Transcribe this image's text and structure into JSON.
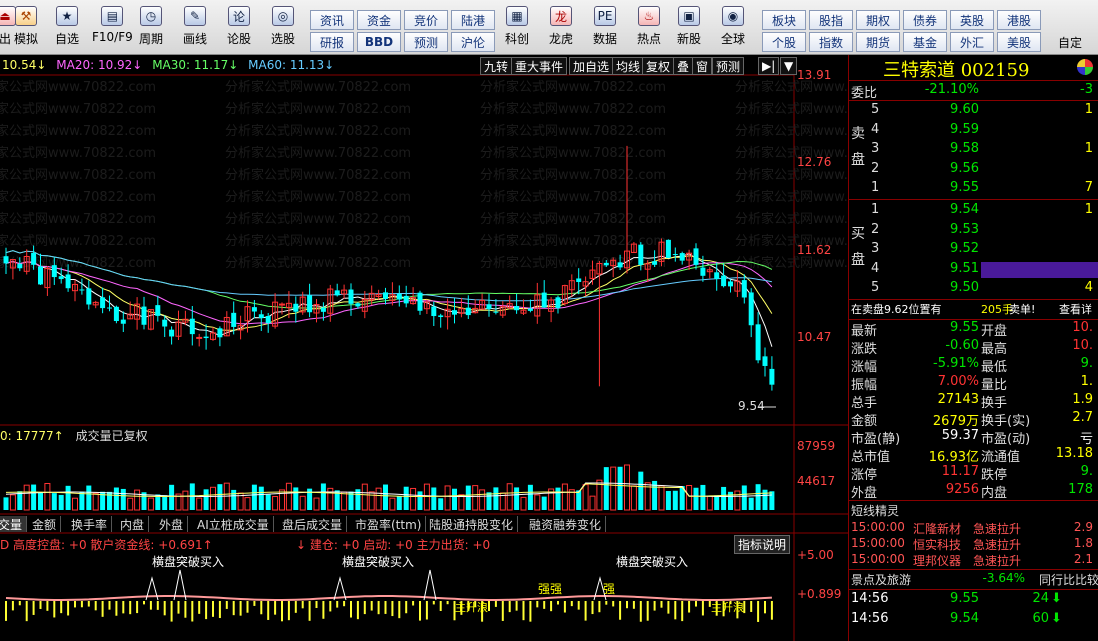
{
  "toolbar": {
    "items": [
      {
        "label": "出",
        "icon": "exit-icon"
      },
      {
        "label": "模拟",
        "icon": "hammer-icon"
      },
      {
        "label": "自选",
        "icon": "star-icon"
      },
      {
        "label": "F10/F9",
        "icon": "f10-icon"
      },
      {
        "label": "周期",
        "icon": "clock-icon"
      },
      {
        "label": "画线",
        "icon": "pen-icon"
      },
      {
        "label": "论股",
        "icon": "chat-icon"
      },
      {
        "label": "选股",
        "icon": "chart-search-icon"
      }
    ],
    "grid_top": [
      "资讯",
      "资金",
      "竞价",
      "陆港"
    ],
    "grid_bottom": [
      "研报",
      "BBD",
      "预测",
      "沪伦"
    ],
    "mid": [
      {
        "label": "科创",
        "icon": "kechuang-icon"
      },
      {
        "label": "龙虎",
        "icon": "dragon-icon"
      },
      {
        "label": "数据",
        "icon": "pe-icon"
      },
      {
        "label": "热点",
        "icon": "hot-icon"
      },
      {
        "label": "新股",
        "icon": "newstock-icon"
      },
      {
        "label": "全球",
        "icon": "globe-icon"
      }
    ],
    "grid2_top": [
      "板块",
      "股指",
      "期权",
      "债券",
      "英股",
      "港股"
    ],
    "grid2_bottom": [
      "个股",
      "指数",
      "期货",
      "基金",
      "外汇",
      "美股"
    ],
    "custom": "自定"
  },
  "ma_legend": {
    "ma10": "10.54↓",
    "ma20": "MA20: 10.92↓",
    "ma30": "MA30: 11.17↓",
    "ma60": "MA60: 11.13↓"
  },
  "chart_buttons": [
    "九转",
    "重大事件",
    "加自选",
    "均线",
    "复权",
    "叠",
    "窗",
    "预测",
    "▶|",
    "▼"
  ],
  "watermark": "分析家公式网www.70822.com",
  "price_axis": [
    "13.91",
    "12.76",
    "11.62",
    "10.47"
  ],
  "last_price_label": "9.54",
  "volume_header": {
    "vol": "0: 17777↑",
    "note": "成交量已复权"
  },
  "volume_axis": [
    "87959",
    "44617"
  ],
  "tabs": [
    "交量",
    "金额",
    "换手率",
    "内盘",
    "外盘",
    "AI立桩成交量",
    "盘后成交量",
    "市盈率(ttm)",
    "陆股通持股变化",
    "融资融券变化"
  ],
  "indicator": {
    "line": "D 高度控盘: +0  散户资金线: +0.691↑",
    "line2": "↓ 建仓: +0  启动: +0  主力出货: +0",
    "help": "指标说明",
    "axis": [
      "+5.00",
      "+0.899"
    ],
    "signals": [
      "横盘突破买入",
      "横盘突破买入",
      "横盘突破买入"
    ],
    "labels": [
      "强强",
      "强",
      "主升浪",
      "主升浪"
    ]
  },
  "stock": {
    "name": "三特索道",
    "code": "002159"
  },
  "commission": {
    "label": "委比",
    "ratio": "-21.10%",
    "diff": "-3"
  },
  "sell": [
    {
      "lvl": "5",
      "price": "9.60",
      "vol": "1"
    },
    {
      "lvl": "4",
      "price": "9.59",
      "vol": ""
    },
    {
      "lvl": "3",
      "price": "9.58",
      "vol": "1"
    },
    {
      "lvl": "2",
      "price": "9.56",
      "vol": ""
    },
    {
      "lvl": "1",
      "price": "9.55",
      "vol": "7"
    }
  ],
  "buy": [
    {
      "lvl": "1",
      "price": "9.54",
      "vol": "1"
    },
    {
      "lvl": "2",
      "price": "9.53",
      "vol": ""
    },
    {
      "lvl": "3",
      "price": "9.52",
      "vol": ""
    },
    {
      "lvl": "4",
      "price": "9.51",
      "vol": ""
    },
    {
      "lvl": "5",
      "price": "9.50",
      "vol": "4"
    }
  ],
  "sell_label": "卖盘",
  "buy_label": "买盘",
  "order_line": {
    "text": "在卖盘9.62位置有",
    "qty": "205手",
    "action": "卖单!",
    "more": "查看详"
  },
  "quote": [
    {
      "l": "最新",
      "v": "9.55",
      "l2": "开盘",
      "v2": "10."
    },
    {
      "l": "涨跌",
      "v": "-0.60",
      "l2": "最高",
      "v2": "10."
    },
    {
      "l": "涨幅",
      "v": "-5.91%",
      "l2": "最低",
      "v2": "9."
    },
    {
      "l": "振幅",
      "v": "7.00%",
      "l2": "量比",
      "v2": "1."
    },
    {
      "l": "总手",
      "v": "27143",
      "l2": "换手",
      "v2": "1.9"
    },
    {
      "l": "金额",
      "v": "2679万",
      "l2": "换手(实)",
      "v2": "2.7"
    },
    {
      "l": "市盈(静)",
      "v": "59.37",
      "l2": "市盈(动)",
      "v2": "亏"
    },
    {
      "l": "总市值",
      "v": "16.93亿",
      "l2": "流通值",
      "v2": "13.18"
    },
    {
      "l": "涨停",
      "v": "11.17",
      "l2": "跌停",
      "v2": "9."
    },
    {
      "l": "外盘",
      "v": "9256",
      "l2": "内盘",
      "v2": "178"
    }
  ],
  "short_title": "短线精灵",
  "short_list": [
    {
      "t": "15:00:00",
      "n": "汇隆新材",
      "e": "急速拉升",
      "v": "2.9"
    },
    {
      "t": "15:00:00",
      "n": "恒实科技",
      "e": "急速拉升",
      "v": "1.8"
    },
    {
      "t": "15:00:00",
      "n": "理邦仪器",
      "e": "急速拉升",
      "v": "2.1"
    }
  ],
  "sector": {
    "name": "景点及旅游",
    "chg": "-3.64%",
    "note": "同行比比较"
  },
  "ticks": [
    {
      "t": "14:56",
      "p": "9.55",
      "v": "24"
    },
    {
      "t": "14:56",
      "p": "9.54",
      "v": "60"
    }
  ],
  "chart_data": {
    "type": "candlestick",
    "price_range": [
      9.2,
      13.91
    ],
    "price_ticks": [
      13.91,
      12.76,
      11.62,
      10.47
    ],
    "volume_ticks": [
      87959,
      44617
    ],
    "last_close": 9.54
  }
}
